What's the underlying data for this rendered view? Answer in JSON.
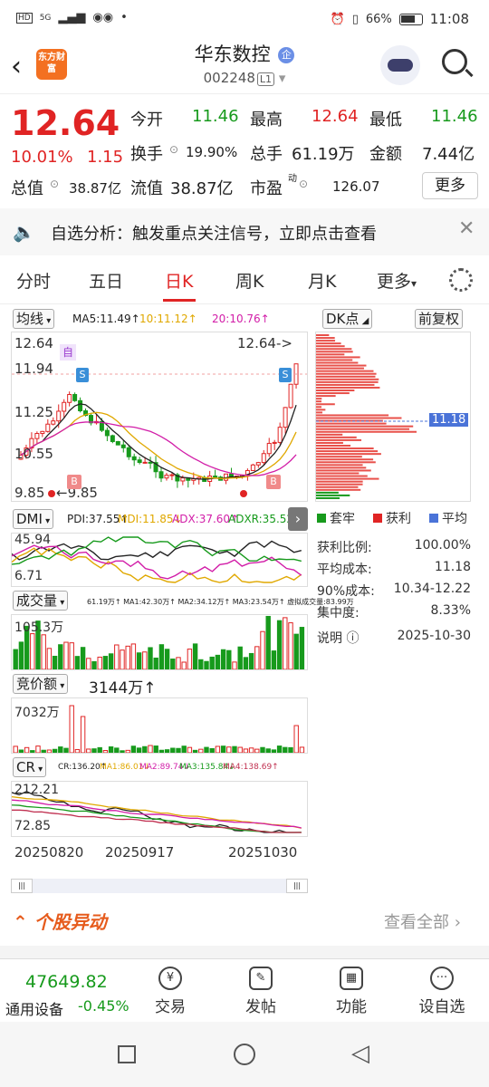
{
  "status": {
    "time": "11:08",
    "battery": "66%",
    "signal": "5G"
  },
  "header": {
    "logo_text": "东方财富",
    "title": "华东数控",
    "badge": "企",
    "code": "002248",
    "market": "L1"
  },
  "quote": {
    "price": "12.64",
    "pct": "10.01%",
    "change": "1.15",
    "open_label": "今开",
    "open": "11.46",
    "high_label": "最高",
    "high": "12.64",
    "low_label": "最低",
    "low": "11.46",
    "turnover_label": "换手",
    "turnover": "19.90%",
    "volume_label": "总手",
    "volume": "61.19万",
    "amount_label": "金额",
    "amount": "7.44亿",
    "total_mv_label": "总值",
    "total_mv": "38.87亿",
    "float_mv_label": "流值",
    "float_mv": "38.87亿",
    "pe_label": "市盈",
    "pe_sup": "动",
    "pe": "126.07",
    "more": "更多"
  },
  "banner": {
    "text": "自选分析：触发重点关注信号，立即点击查看"
  },
  "tabs": [
    "分时",
    "五日",
    "日K",
    "周K",
    "月K",
    "更多"
  ],
  "chart": {
    "ma_label": "均线",
    "ma5": "MA5:11.49↑",
    "ma10": "10:11.12↑",
    "ma20": "20:10.76↑",
    "y_top": "12.64",
    "y2": "11.94",
    "y3": "11.25",
    "y4": "10.55",
    "y_low": "9.85",
    "low_note": "←9.85",
    "high_note": "12.64->",
    "mark_zi": "自",
    "mark_s": "S",
    "mark_b": "B",
    "dk_label": "DK点",
    "fq_label": "前复权",
    "avg_cost_tag": "11.18",
    "dmi_label": "DMI",
    "pdi": "PDI:37.55↑",
    "mdi": "MDI:11.85↓",
    "adx": "ADX:37.60↑",
    "adxr": "ADXR:35.52↑",
    "dmi_top": "45.94",
    "dmi_low": "6.71",
    "vol_label": "成交量",
    "vol_ind": "61.19万↑ MA1:42.30万↑ MA2:34.12万↑ MA3:23.54万↑ 虚拟成交量:83.99万",
    "vol_top": "105.3万",
    "bid_label": "竞价额",
    "bid_val": "3144万↑",
    "bid_top": "7032万",
    "cr_label": "CR",
    "cr": "CR:136.20↑",
    "cr_ma1": "MA1:86.01↓",
    "cr_ma2": "MA2:89.74↓",
    "cr_ma3": "MA3:135.84↓",
    "cr_ma4": "MA4:138.69↑",
    "cr_top": "212.21",
    "cr_low": "72.85",
    "dates": [
      "20250820",
      "20250917",
      "20251030"
    ]
  },
  "chip": {
    "legend": [
      "套牢",
      "获利",
      "平均"
    ],
    "rows": [
      {
        "label": "获利比例:",
        "value": "100.00%"
      },
      {
        "label": "平均成本:",
        "value": "11.18"
      },
      {
        "label": "90%成本:",
        "value": "10.34-12.22"
      },
      {
        "label": "集中度:",
        "value": "8.33%"
      }
    ],
    "note_label": "说明",
    "note_date": "2025-10-30"
  },
  "movement": {
    "title": "个股异动",
    "view_all": "查看全部"
  },
  "bottom": {
    "index_value": "47649.82",
    "index_name": "通用设备",
    "index_pct": "-0.45%",
    "items": [
      "交易",
      "发帖",
      "功能",
      "设自选"
    ]
  },
  "colors": {
    "up": "#e02424",
    "down": "#179a1c",
    "brand": "#f37021"
  }
}
